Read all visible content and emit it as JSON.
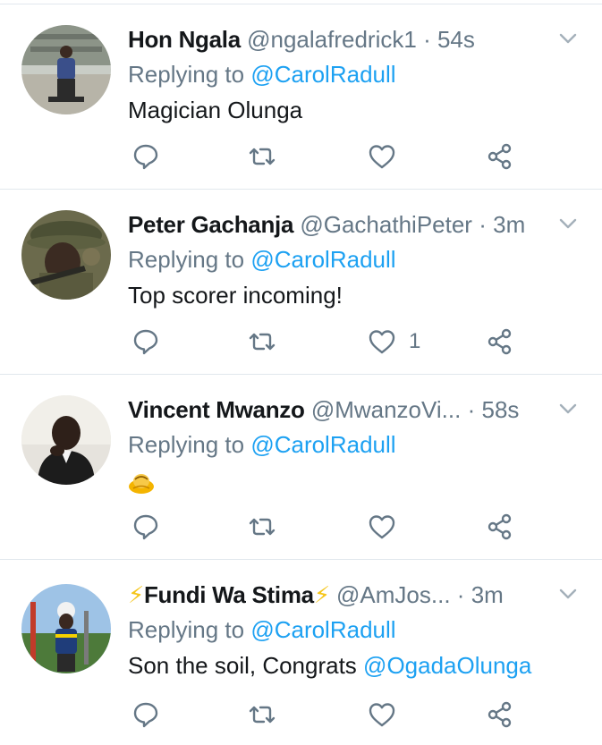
{
  "tweets": [
    {
      "name": "Hon Ngala",
      "handle": "@ngalafredrick1",
      "separator": "·",
      "time": "54s",
      "replying_prefix": "Replying to",
      "replying_to": "@CarolRadull",
      "text": "Magician Olunga",
      "like_count": ""
    },
    {
      "name": "Peter Gachanja",
      "handle": "@GachathiPeter",
      "separator": "·",
      "time": "3m",
      "replying_prefix": "Replying to",
      "replying_to": "@CarolRadull",
      "text": "Top scorer incoming!",
      "like_count": "1"
    },
    {
      "name": "Vincent Mwanzo",
      "handle": "@MwanzoVi...",
      "separator": "·",
      "time": "58s",
      "replying_prefix": "Replying to",
      "replying_to": "@CarolRadull",
      "emoji": "person-bowing-emoji",
      "like_count": ""
    },
    {
      "name_bolt_left": "⚡",
      "name": "Fundi Wa Stima",
      "name_bolt_right": "⚡",
      "handle": "@AmJos...",
      "separator": "·",
      "time": "3m",
      "replying_prefix": "Replying to",
      "replying_to": "@CarolRadull",
      "text": "Son the soil, Congrats ",
      "text_mention": "@OgadaOlunga",
      "like_count": ""
    }
  ],
  "colors": {
    "link": "#1da1f2",
    "secondary_text": "#657786",
    "divider": "#e1e8ed",
    "bolt": "#f5c518"
  },
  "icons": [
    "reply-icon",
    "retweet-icon",
    "like-icon",
    "share-icon",
    "chevron-down-icon"
  ]
}
